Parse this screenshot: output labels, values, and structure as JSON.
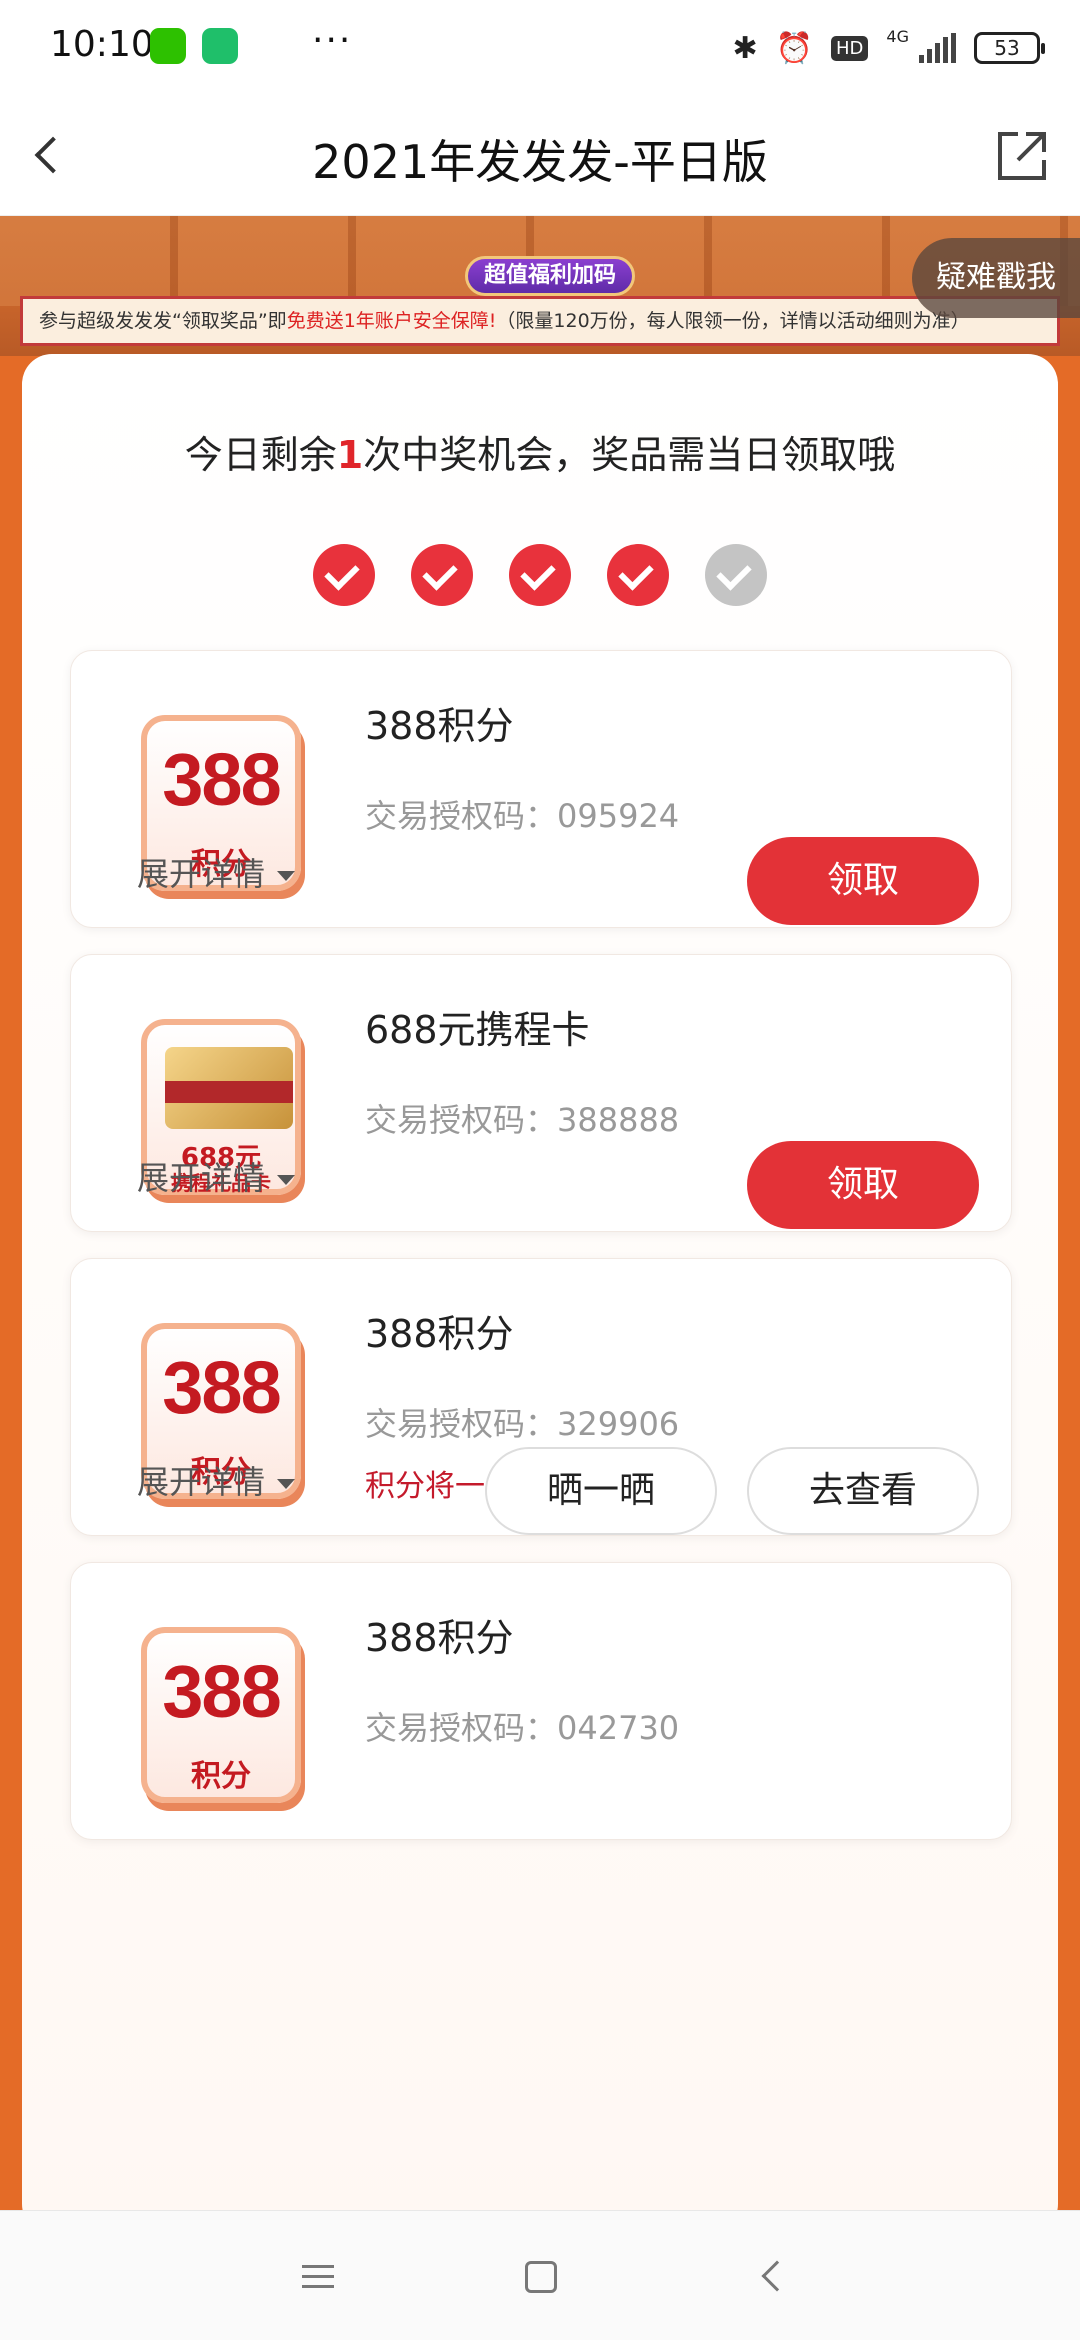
{
  "status_bar": {
    "time": "10:10",
    "more": "···",
    "hd": "HD",
    "network": "4G",
    "battery": "53",
    "apps": [
      "wechat-icon",
      "shield-icon",
      "note-icon"
    ]
  },
  "header": {
    "title": "2021年发发发-平日版",
    "back_icon": "chevron-left-icon",
    "share_icon": "external-share-icon"
  },
  "banner": {
    "pill": "超值福利加码",
    "strip_prefix": "参与超级发发发“领取奖品”即",
    "strip_highlight": "免费送1年账户安全保障!",
    "strip_suffix": "（限量120万份，每人限领一份，详情以活动细则为准）",
    "help_tab": "疑难戳我"
  },
  "draw": {
    "text_before": "今日剩余",
    "remaining": "1",
    "text_after": "次中奖机会，奖品需当日领取哦",
    "checks_done": 4,
    "checks_total": 5
  },
  "prizes": [
    {
      "name": "388积分",
      "auth_code": "交易授权码：095924",
      "thumb_big": "388",
      "thumb_small": "积分",
      "expand": "展开详情",
      "claim": "领取"
    },
    {
      "name": "688元携程卡",
      "auth_code": "交易授权码：388888",
      "thumb_big": "688元",
      "thumb_small": "携程礼品卡",
      "expand": "展开详情",
      "claim": "领取"
    },
    {
      "name": "388积分",
      "auth_code": "交易授权码：329906",
      "note": "积分将一周内到账",
      "thumb_big": "388",
      "thumb_small": "积分",
      "expand": "展开详情",
      "share": "晒一晒",
      "view": "去查看"
    },
    {
      "name": "388积分",
      "auth_code": "交易授权码：042730",
      "thumb_big": "388",
      "thumb_small": "积分"
    }
  ],
  "colors": {
    "accent_red": "#e33237",
    "frame_orange": "#e46b27",
    "note_red": "#c41a2b"
  }
}
